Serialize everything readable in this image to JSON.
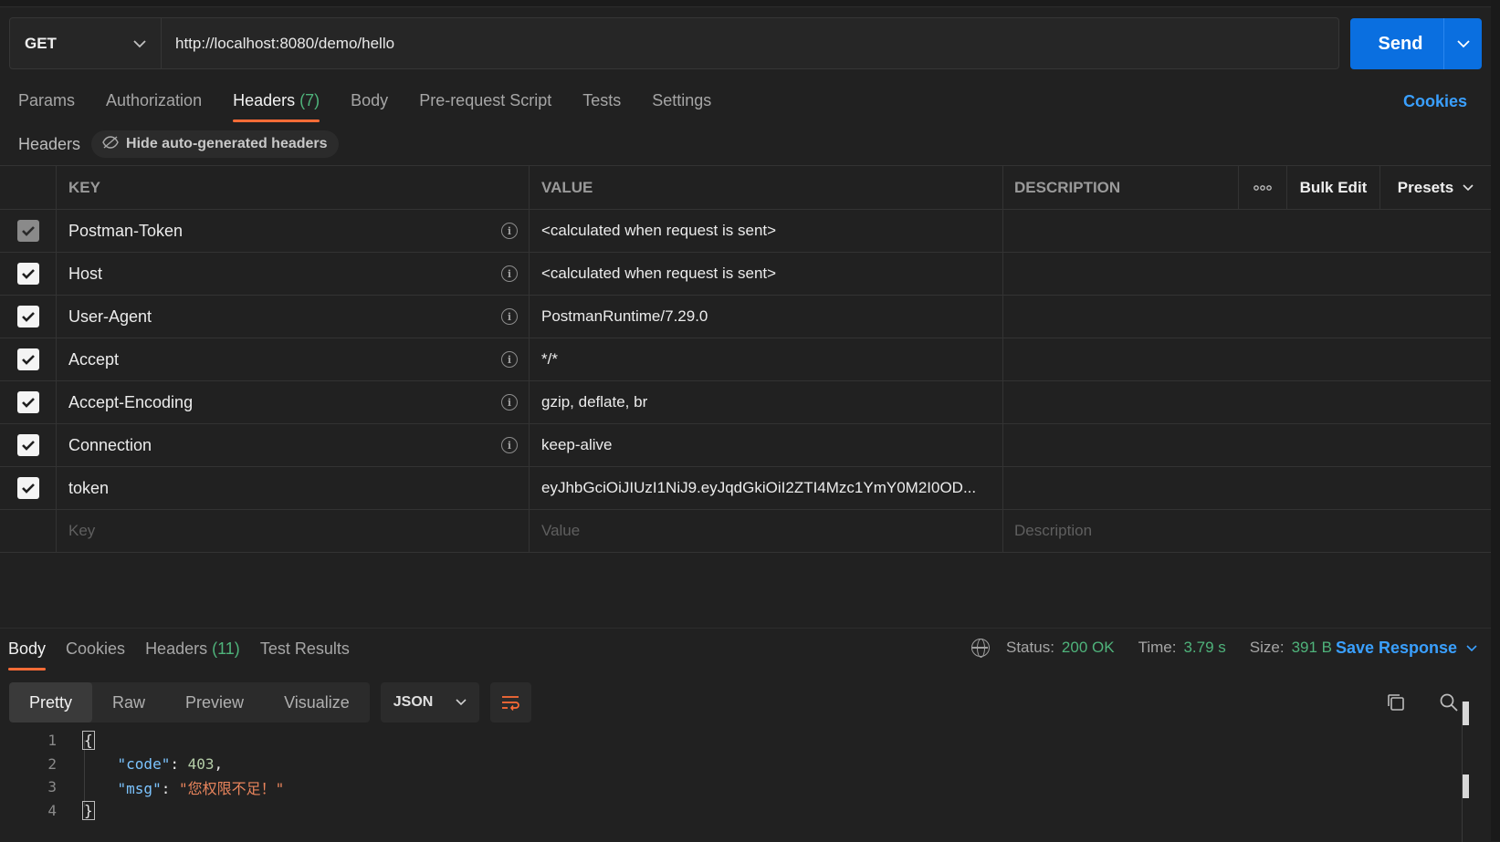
{
  "request": {
    "method": "GET",
    "url": "http://localhost:8080/demo/hello",
    "send_label": "Send"
  },
  "request_tabs": [
    {
      "label": "Params",
      "active": false
    },
    {
      "label": "Authorization",
      "active": false
    },
    {
      "label": "Headers",
      "count": "(7)",
      "active": true
    },
    {
      "label": "Body",
      "active": false
    },
    {
      "label": "Pre-request Script",
      "active": false
    },
    {
      "label": "Tests",
      "active": false
    },
    {
      "label": "Settings",
      "active": false
    }
  ],
  "cookies_label": "Cookies",
  "headers_bar": {
    "title": "Headers",
    "hide_label": "Hide auto-generated headers"
  },
  "table": {
    "col_key": "KEY",
    "col_value": "VALUE",
    "col_description": "DESCRIPTION",
    "bulk_edit": "Bulk Edit",
    "presets": "Presets",
    "rows": [
      {
        "key": "Postman-Token",
        "value": "<calculated when request is sent>",
        "checked": true,
        "locked": true,
        "info": true
      },
      {
        "key": "Host",
        "value": "<calculated when request is sent>",
        "checked": true,
        "locked": false,
        "info": true
      },
      {
        "key": "User-Agent",
        "value": "PostmanRuntime/7.29.0",
        "checked": true,
        "locked": false,
        "info": true
      },
      {
        "key": "Accept",
        "value": "*/*",
        "checked": true,
        "locked": false,
        "info": true
      },
      {
        "key": "Accept-Encoding",
        "value": "gzip, deflate, br",
        "checked": true,
        "locked": false,
        "info": true
      },
      {
        "key": "Connection",
        "value": "keep-alive",
        "checked": true,
        "locked": false,
        "info": true
      },
      {
        "key": "token",
        "value": "eyJhbGciOiJIUzI1NiJ9.eyJqdGkiOiI2ZTI4Mzc1YmY0M2I0OD...",
        "checked": true,
        "locked": false,
        "info": false
      }
    ],
    "placeholder": {
      "key": "Key",
      "value": "Value",
      "description": "Description"
    }
  },
  "response": {
    "tabs": [
      {
        "label": "Body",
        "active": true
      },
      {
        "label": "Cookies",
        "active": false
      },
      {
        "label": "Headers",
        "count": "(11)",
        "active": false
      },
      {
        "label": "Test Results",
        "active": false
      }
    ],
    "status_label": "Status:",
    "status_value": "200 OK",
    "time_label": "Time:",
    "time_value": "3.79 s",
    "size_label": "Size:",
    "size_value": "391 B",
    "save_label": "Save Response",
    "views": [
      "Pretty",
      "Raw",
      "Preview",
      "Visualize"
    ],
    "active_view": "Pretty",
    "format": "JSON",
    "code": {
      "line_numbers": [
        "1",
        "2",
        "3",
        "4"
      ],
      "open_brace": "{",
      "close_brace": "}",
      "code_key": "\"code\"",
      "code_value": "403",
      "msg_key": "\"msg\"",
      "msg_value": "\"您权限不足！\""
    }
  },
  "colors": {
    "accent_send": "#0a6fe0",
    "tab_indicator": "#ff6c37",
    "link": "#3aa0ff",
    "success": "#4fb37b"
  }
}
